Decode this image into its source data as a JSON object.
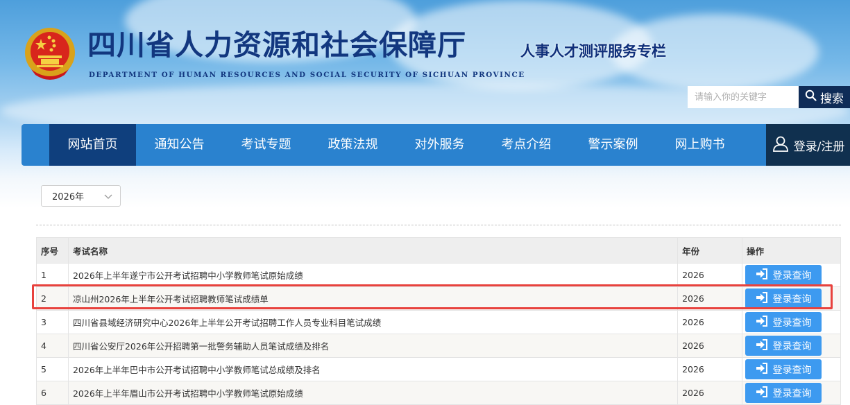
{
  "header": {
    "title": "四川省人力资源和社会保障厅",
    "subtitle": "DEPARTMENT OF HUMAN RESOURCES AND SOCIAL SECURITY OF SICHUAN PROVINCE",
    "column_title": "人事人才测评服务专栏",
    "emblem_icon": "national-emblem-icon"
  },
  "search": {
    "placeholder": "请输入你的关键字",
    "button_label": "搜索",
    "icon": "search-icon"
  },
  "nav": {
    "items": [
      {
        "label": "网站首页",
        "active": true
      },
      {
        "label": "通知公告"
      },
      {
        "label": "考试专题"
      },
      {
        "label": "政策法规"
      },
      {
        "label": "对外服务"
      },
      {
        "label": "考点介绍"
      },
      {
        "label": "警示案例"
      },
      {
        "label": "网上购书"
      }
    ],
    "login_label": "登录/注册",
    "login_icon": "user-icon"
  },
  "filter": {
    "year_value": "2026年"
  },
  "table": {
    "headers": {
      "index": "序号",
      "name": "考试名称",
      "year": "年份",
      "action": "操作"
    },
    "action_label": "登录查询",
    "action_icon": "sign-in-icon",
    "rows": [
      {
        "index": "1",
        "name": "2026年上半年遂宁市公开考试招聘中小学教师笔试原始成绩",
        "year": "2026"
      },
      {
        "index": "2",
        "name": "凉山州2026年上半年公开考试招聘教师笔试成绩单",
        "year": "2026"
      },
      {
        "index": "3",
        "name": "四川省县域经济研究中心2026年上半年公开考试招聘工作人员专业科目笔试成绩",
        "year": "2026"
      },
      {
        "index": "4",
        "name": "四川省公安厅2026年公开招聘第一批警务辅助人员笔试成绩及排名",
        "year": "2026"
      },
      {
        "index": "5",
        "name": "2026年上半年巴中市公开考试招聘中小学教师笔试总成绩及排名",
        "year": "2026"
      },
      {
        "index": "6",
        "name": "2026年上半年眉山市公开考试招聘中小学教师笔试原始成绩",
        "year": "2026"
      }
    ],
    "highlighted_row": 2
  },
  "colors": {
    "brand_dark": "#12377f",
    "nav_blue": "#2a82cf",
    "nav_active": "#0f3f7d",
    "button_blue": "#3d9af0",
    "highlight_red": "#e8423d"
  }
}
